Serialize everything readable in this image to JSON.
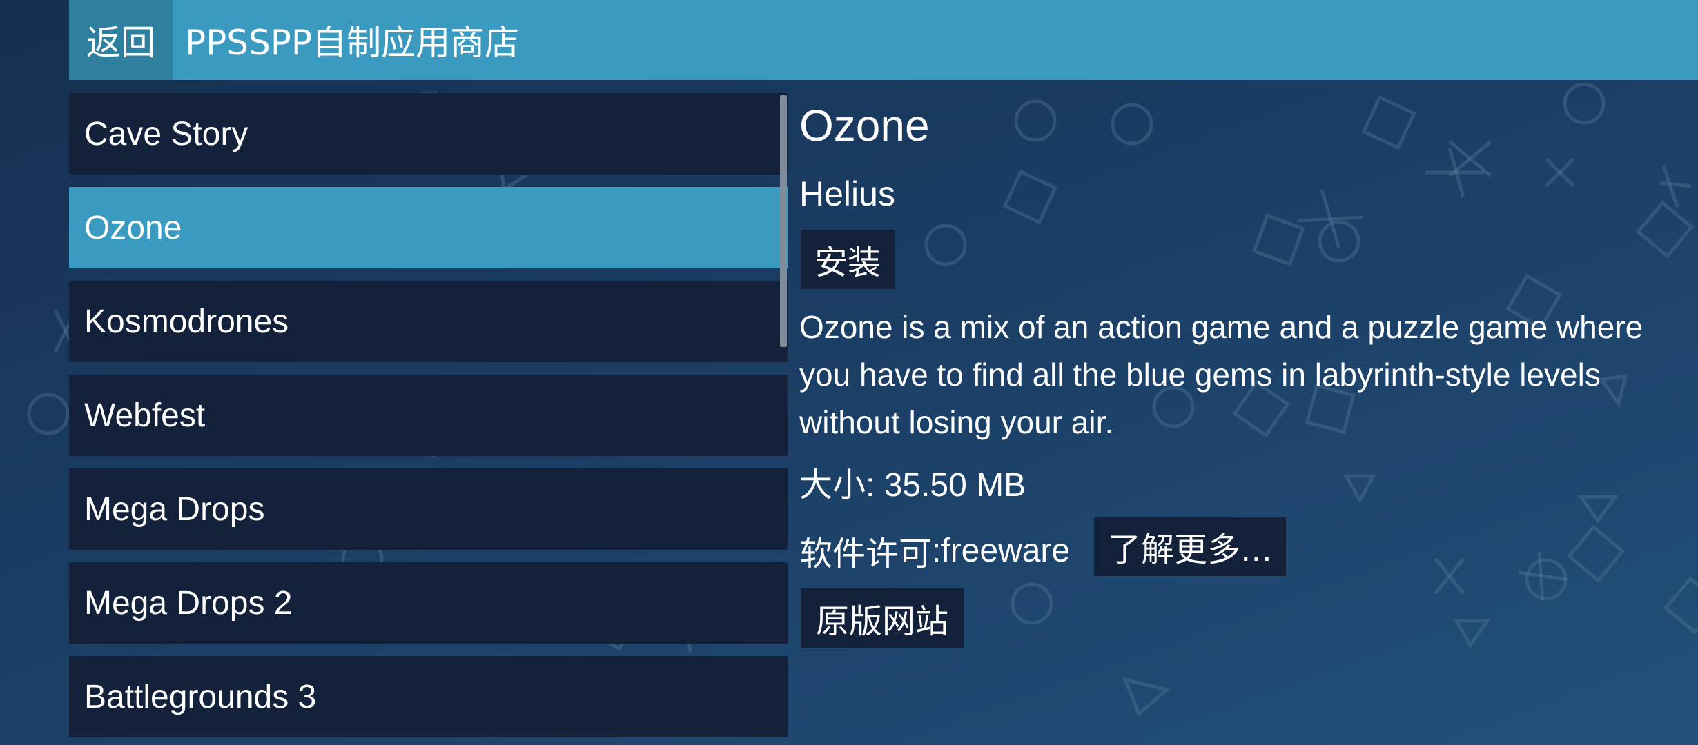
{
  "header": {
    "back_label": "返回",
    "title": "PPSSPP自制应用商店"
  },
  "app_list": [
    {
      "name": "Cave Story"
    },
    {
      "name": "Ozone",
      "selected": true
    },
    {
      "name": "Kosmodrones"
    },
    {
      "name": "Webfest"
    },
    {
      "name": "Mega Drops"
    },
    {
      "name": "Mega Drops 2"
    },
    {
      "name": "Battlegrounds 3"
    }
  ],
  "detail": {
    "title": "Ozone",
    "author": "Helius",
    "install_label": "安装",
    "description": "Ozone is a mix of an action game and a puzzle game where you have to find all the blue gems in labyrinth-style levels without losing your air.",
    "size_label": "大小",
    "size_value": "35.50 MB",
    "license_label": "软件许可",
    "license_value": "freeware",
    "learn_more_label": "了解更多...",
    "website_label": "原版网站"
  },
  "colors": {
    "header_bar": "#3a9ac0",
    "back_button": "#2f7f9f",
    "list_item_bg": "#13223a",
    "selected_item_bg": "#3a9ac0",
    "background": "#1b3d64"
  },
  "icons": {
    "background_pattern": "playstation-shapes-pattern"
  }
}
